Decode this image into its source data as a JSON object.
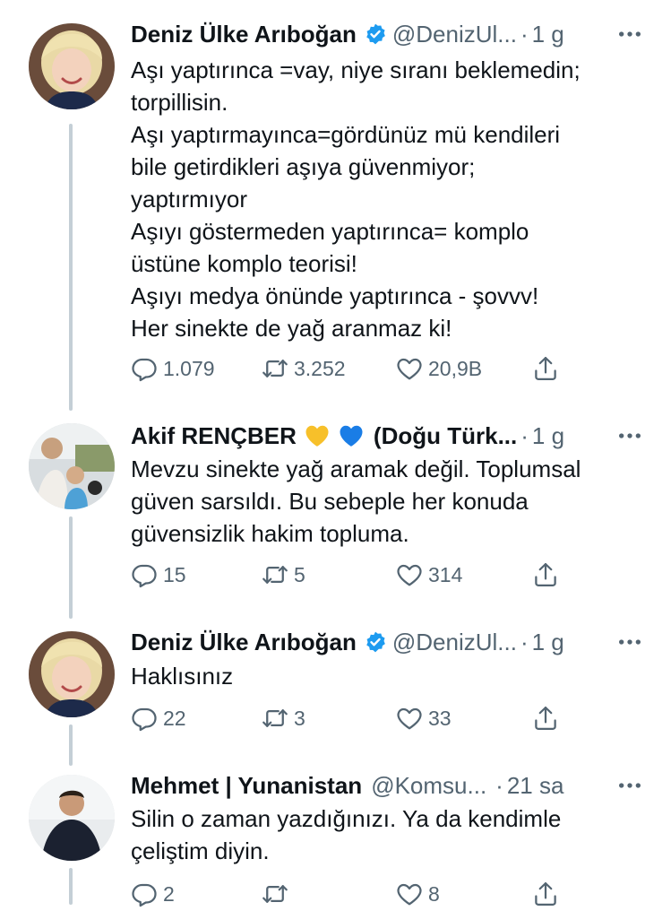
{
  "tweets": [
    {
      "name": "Deniz Ülke Arıboğan",
      "handle": "@DenizUl...",
      "sep": "·",
      "time": "1 g",
      "lines": [
        "Aşı yaptırınca =vay, niye sıranı beklemedin;",
        "torpillisin.",
        "Aşı yaptırmayınca=gördünüz mü kendileri",
        "bile getirdikleri aşıya güvenmiyor;",
        "yaptırmıyor",
        "Aşıyı göstermeden yaptırınca= komplo",
        "üstüne komplo teorisi!",
        "Aşıyı medya önünde yaptırınca - şovvv!",
        "Her sinekte de yağ aranmaz ki!"
      ],
      "replies": "1.079",
      "retweets": "3.252",
      "likes": "20,9B"
    },
    {
      "name": "Akif RENÇBER",
      "emoji": [
        "yellow-heart",
        "blue-heart"
      ],
      "handle": "(Doğu Türk...",
      "sep": "·",
      "time": "1 g",
      "lines": [
        "Mevzu sinekte yağ aramak değil. Toplumsal",
        "güven sarsıldı. Bu sebeple her konuda",
        "güvensizlik hakim topluma."
      ],
      "replies": "15",
      "retweets": "5",
      "likes": "314"
    },
    {
      "name": "Deniz Ülke Arıboğan",
      "handle": "@DenizUl...",
      "sep": "·",
      "time": "1 g",
      "lines": [
        "Haklısınız"
      ],
      "replies": "22",
      "retweets": "3",
      "likes": "33"
    },
    {
      "name": "Mehmet | Yunanistan",
      "handle": "@Komsu...",
      "sep": "·",
      "time": "21 sa",
      "lines": [
        "Silin o zaman yazdığınızı. Ya da kendimle",
        "çeliştim diyin."
      ],
      "replies": "2",
      "retweets": "",
      "likes": "8"
    }
  ],
  "colors": {
    "text": "#0f1419",
    "secondary": "#536471",
    "verified": "#1d9bf0",
    "thread_line": "#c4cfd6"
  }
}
